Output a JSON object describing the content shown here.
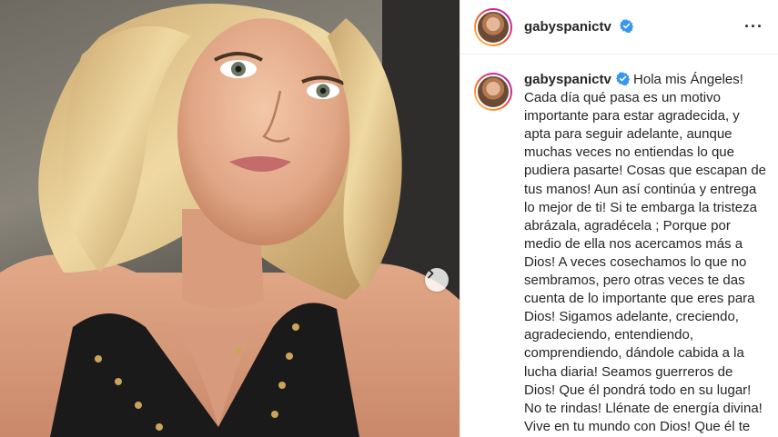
{
  "post": {
    "username": "gabyspanictv",
    "verified": true,
    "more_icon": "more-horizontal-icon",
    "next_icon": "chevron-right-icon"
  },
  "caption": {
    "username": "gabyspanictv",
    "text": "Hola mis Ángeles! Cada día qué pasa es un motivo importante para estar agradecida, y apta para seguir adelante, aunque muchas veces no entiendas lo que pudiera pasarte! Cosas que escapan de tus manos! Aun así continúa y entrega lo mejor de ti! Si te embarga la tristeza abrázala, agradécela ; Porque por medio de ella nos acercamos más a Dios! A veces cosechamos lo que no sembramos, pero otras veces te das cuenta de lo importante que eres para Dios! Sigamos adelante, creciendo, agradeciendo, entendiendo, comprendiendo, dándole cabida a la lucha diaria! Seamos guerreros de Dios! Que él pondrá todo en su lugar! No te rindas! Llénate de energía divina! Vive en tu mundo con Dios! Que él te"
  },
  "colors": {
    "verified": "#3897f0",
    "text": "#262626",
    "border": "#efefef"
  }
}
